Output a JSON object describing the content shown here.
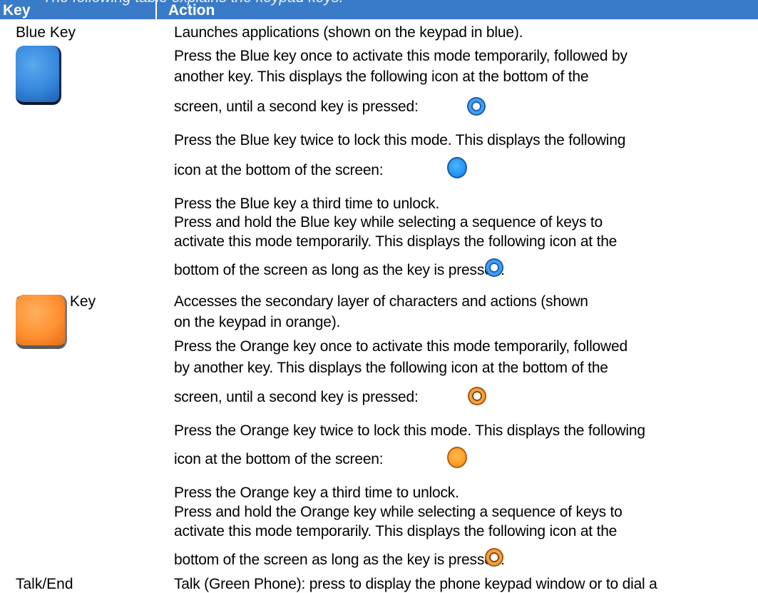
{
  "table": {
    "header_overflow_text": "The following table explains the keypad keys.",
    "columns": {
      "key": "Key",
      "action": "Action"
    },
    "blue": {
      "label": "Blue Key",
      "line1": "Launches applications (shown on the keypad in blue).",
      "once1": "Press the Blue key once to activate this mode temporarily, followed by",
      "once2": "another key. This displays the following icon at the bottom of the",
      "once3": "screen, until a second key is pressed:",
      "twice1": "Press the Blue key twice to lock this mode. This displays the following",
      "twice2": "icon at the bottom of the screen:",
      "third": "Press the Blue key a third time to unlock.",
      "hold1": "Press and hold the Blue key while selecting a sequence of keys to",
      "hold2": "activate this mode temporarily. This displays the following icon at the",
      "hold3": "bottom of the screen as long as the key is pressed:"
    },
    "orange": {
      "label": "Orange Key",
      "line1": "Accesses the secondary layer of characters and actions (shown",
      "line2": "on the keypad in orange).",
      "once1": "Press the Orange key once to activate this mode temporarily, followed",
      "once2": "by another key. This displays the following icon at the bottom of the",
      "once3": "screen, until a second key is pressed:",
      "twice1": "Press the Orange key twice to lock this mode. This displays the following",
      "twice2": "icon at the bottom of the screen:",
      "third": "Press the Orange key a third time to unlock.",
      "hold1": "Press and hold the Orange key while selecting a sequence of keys to",
      "hold2": "activate this mode temporarily. This displays the following icon at the",
      "hold3": "bottom of the screen as long as the key is pressed:"
    },
    "talk": {
      "label": "Talk/End",
      "line1": "Talk (Green Phone): press to display the phone keypad window or to dial a"
    },
    "colors": {
      "header_bg": "#3a7bc8",
      "blue_key": "#3688dc",
      "orange_key": "#ff9030"
    },
    "icons": [
      "blue-key-icon",
      "blue-temporary-mode-icon",
      "blue-locked-mode-icon",
      "orange-key-icon",
      "orange-temporary-mode-icon",
      "orange-locked-mode-icon"
    ]
  }
}
